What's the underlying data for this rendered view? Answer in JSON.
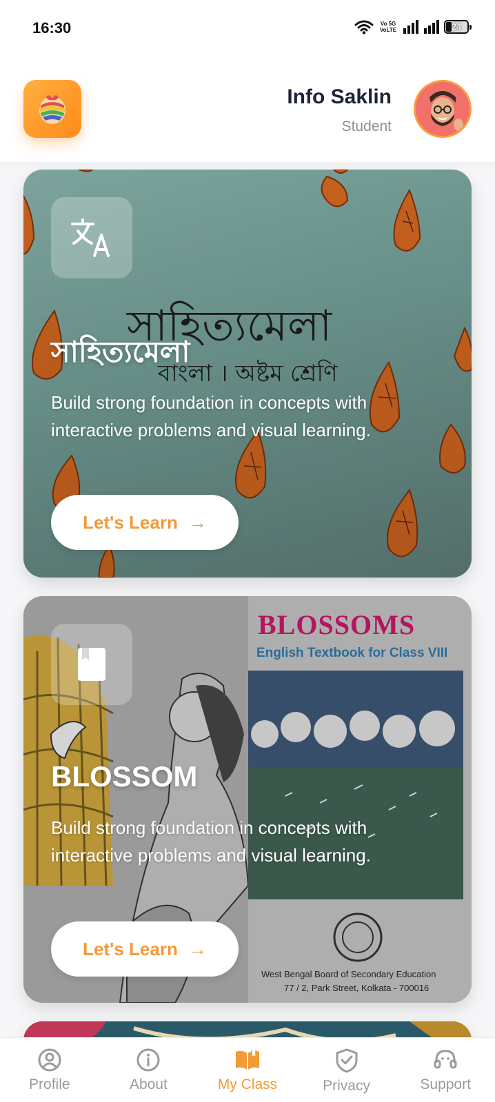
{
  "status_bar": {
    "time": "16:30",
    "volte_top": "Vo 5G",
    "volte_bottom": "VoLTE",
    "battery": "24",
    "battery_level": 0.24
  },
  "header": {
    "user_name": "Info Saklin",
    "user_role": "Student",
    "logo_icon": "app-logo-icon",
    "avatar_icon": "avatar-memoji"
  },
  "cards": [
    {
      "icon": "translate-icon",
      "cover_title": "সাহিত্যমেলা",
      "cover_subtitle": "বাংলা । অষ্টম শ্রেণি",
      "title": "সাহিত্যমেলা",
      "description": "Build strong foundation in concepts with interactive problems and visual learning.",
      "button_label": "Let's Learn",
      "button_arrow": "→"
    },
    {
      "icon": "book-icon",
      "cover_title": "BLOSSOMS",
      "cover_subtitle": "English Textbook for Class VIII",
      "cover_publisher": "West Bengal Board of Secondary Education",
      "cover_address": "77 / 2, Park Street, Kolkata - 700016",
      "title": "BLOSSOM",
      "description": "Build strong foundation in concepts with interactive problems and visual learning.",
      "button_label": "Let's Learn",
      "button_arrow": "→"
    }
  ],
  "nav": {
    "items": [
      {
        "label": "Profile",
        "icon": "profile-icon",
        "active": false
      },
      {
        "label": "About",
        "icon": "info-icon",
        "active": false
      },
      {
        "label": "My Class",
        "icon": "open-book-icon",
        "active": true
      },
      {
        "label": "Privacy",
        "icon": "shield-check-icon",
        "active": false
      },
      {
        "label": "Support",
        "icon": "headset-icon",
        "active": false
      }
    ]
  },
  "colors": {
    "accent": "#f29a35",
    "title_dark": "#1d2236",
    "muted": "#8a8f99",
    "nav_inactive": "#9a9a9a"
  }
}
